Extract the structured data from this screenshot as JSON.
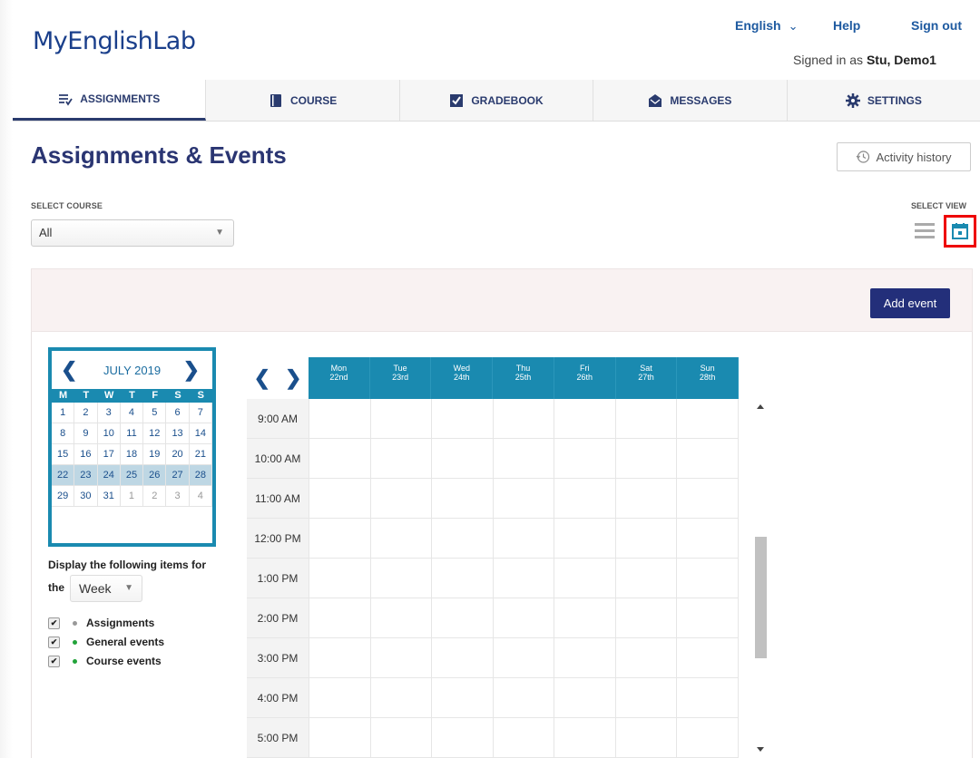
{
  "header": {
    "logo": "MyEnglishLab",
    "language": "English",
    "help": "Help",
    "sign_out": "Sign out",
    "signed_in_prefix": "Signed in as ",
    "user": "Stu, Demo1"
  },
  "nav": {
    "tabs": [
      {
        "label": "ASSIGNMENTS",
        "icon": "assignments-icon",
        "active": true
      },
      {
        "label": "COURSE",
        "icon": "book-icon",
        "active": false
      },
      {
        "label": "GRADEBOOK",
        "icon": "checkbox-icon",
        "active": false
      },
      {
        "label": "MESSAGES",
        "icon": "mail-icon",
        "active": false
      },
      {
        "label": "SETTINGS",
        "icon": "gear-icon",
        "active": false
      }
    ]
  },
  "page": {
    "title": "Assignments & Events",
    "activity_history": "Activity history",
    "select_course_label": "SELECT COURSE",
    "course_value": "All",
    "select_view_label": "SELECT VIEW",
    "add_event": "Add event"
  },
  "mini_calendar": {
    "month": "JULY 2019",
    "dow": [
      "M",
      "T",
      "W",
      "T",
      "F",
      "S",
      "S"
    ],
    "weeks": [
      [
        "1",
        "2",
        "3",
        "4",
        "5",
        "6",
        "7"
      ],
      [
        "8",
        "9",
        "10",
        "11",
        "12",
        "13",
        "14"
      ],
      [
        "15",
        "16",
        "17",
        "18",
        "19",
        "20",
        "21"
      ],
      [
        "22",
        "23",
        "24",
        "25",
        "26",
        "27",
        "28"
      ],
      [
        "29",
        "30",
        "31",
        "1",
        "2",
        "3",
        "4"
      ]
    ],
    "selected_week": 3
  },
  "display": {
    "text": "Display the following items for",
    "the": "the",
    "period": "Week",
    "legend": [
      {
        "label": "Assignments",
        "color": "#999999",
        "checked": true
      },
      {
        "label": "General events",
        "color": "#22a33a",
        "checked": true
      },
      {
        "label": "Course events",
        "color": "#22a33a",
        "checked": true
      }
    ]
  },
  "week": {
    "days": [
      {
        "day": "Mon",
        "date": "22nd"
      },
      {
        "day": "Tue",
        "date": "23rd"
      },
      {
        "day": "Wed",
        "date": "24th"
      },
      {
        "day": "Thu",
        "date": "25th"
      },
      {
        "day": "Fri",
        "date": "26th"
      },
      {
        "day": "Sat",
        "date": "27th"
      },
      {
        "day": "Sun",
        "date": "28th"
      }
    ],
    "times": [
      "9:00 AM",
      "10:00 AM",
      "11:00 AM",
      "12:00 PM",
      "1:00 PM",
      "2:00 PM",
      "3:00 PM",
      "4:00 PM",
      "5:00 PM"
    ]
  },
  "colors": {
    "brand": "#2a3572",
    "accent": "#1a8ab0",
    "button": "#232f7a",
    "highlight_border": "#e00000"
  }
}
